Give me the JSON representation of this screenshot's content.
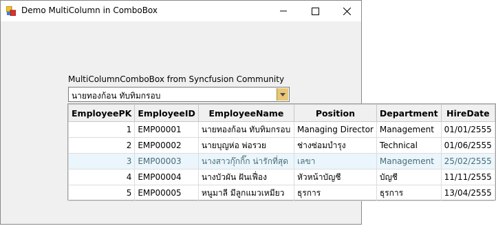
{
  "window": {
    "title": "Demo MultiColumn in ComboBox",
    "controls": {
      "minimize": "minimize-icon",
      "maximize": "maximize-icon",
      "close": "close-icon"
    }
  },
  "form": {
    "label": "MultiColumnComboBox from Syncfusion Community",
    "combo_value": "นายทองก้อน ทับทิมกรอบ"
  },
  "grid": {
    "headers": [
      "EmployeePK",
      "EmployeeID",
      "EmployeeName",
      "Position",
      "Department",
      "HireDate"
    ],
    "rows": [
      [
        "1",
        "EMP00001",
        "นายทองก้อน ทับทิมกรอบ",
        "Managing Director",
        "Management",
        "01/01/2555"
      ],
      [
        "2",
        "EMP00002",
        "นายบุญห่อ พ่อรวย",
        "ช่างซ่อมบำรุง",
        "Technical",
        "01/06/2555"
      ],
      [
        "3",
        "EMP00003",
        "นางสาวกุ๊กกิ๊ก น่ารักที่สุด",
        "เลขา",
        "Management",
        "25/02/2555"
      ],
      [
        "4",
        "EMP00004",
        "นางบัวผัน ฝันเฟื่อง",
        "หัวหน้าบัญชี",
        "บัญชี",
        "11/11/2555"
      ],
      [
        "5",
        "EMP00005",
        "หนูมาลี มีลูกแมวเหมียว",
        "ธุรการ",
        "ธุรการ",
        "13/04/2555"
      ]
    ],
    "selected_row": 2
  }
}
